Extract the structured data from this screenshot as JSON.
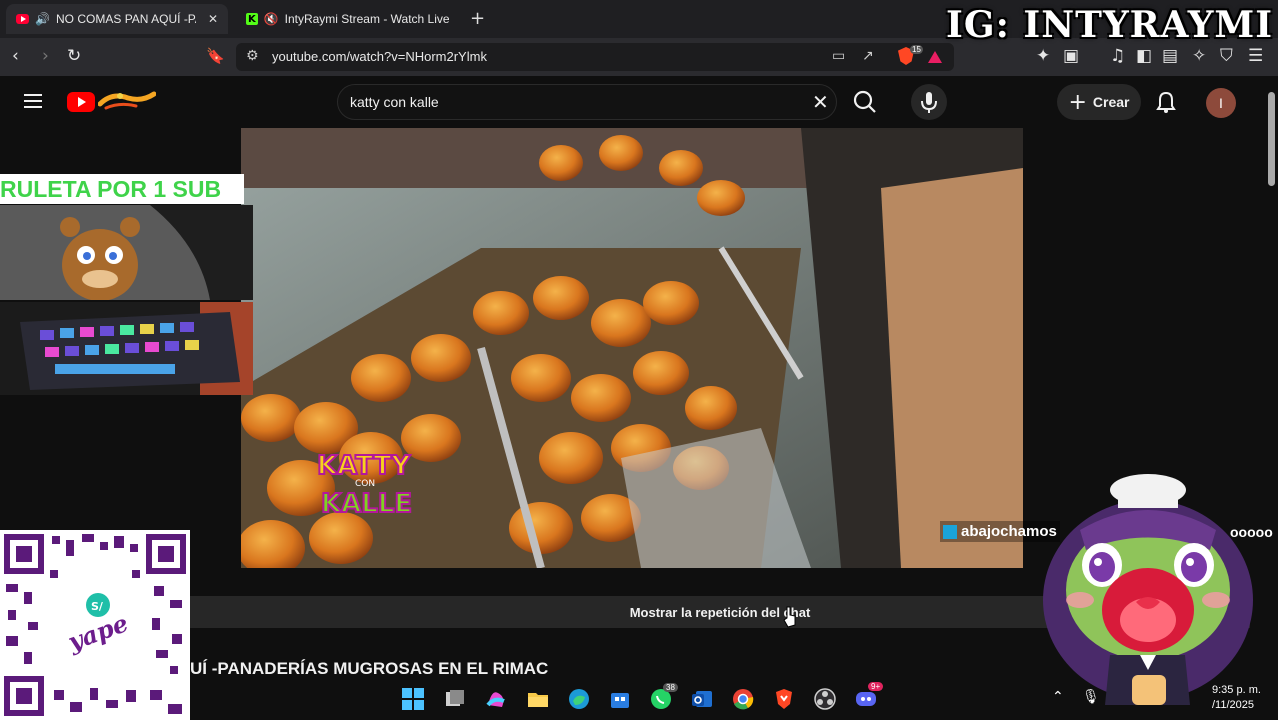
{
  "browser": {
    "tabs": [
      {
        "title": "NO COMAS PAN AQUÍ -PANA",
        "active": true,
        "favicon": "youtube-icon",
        "audio": "speaker-icon"
      },
      {
        "title": "IntyRaymi Stream - Watch Live or",
        "active": false,
        "favicon": "kick-icon",
        "audio": "muted-speaker-icon"
      }
    ],
    "url": "youtube.com/watch?v=NHorm2rYlmk",
    "brave_shield_count": "15"
  },
  "youtube": {
    "search_query": "katty con kalle",
    "create_label": "Crear",
    "avatar_initial": "I",
    "chat_replay_label": "Mostrar la repetición del chat",
    "video_title_visible": "UÍ -PANADERÍAS MUGROSAS EN EL RIMAC",
    "video_watermark": [
      "KATTY",
      "CON",
      "KALLE"
    ]
  },
  "overlays": {
    "instagram": "IG: INTYRAYMI",
    "ruleta": "RULETA POR 1 SUB",
    "chat_username": "abajochamos",
    "chat_message_fragment": "ooooo",
    "qr_brand": "yape",
    "qr_currency": "S/"
  },
  "taskbar": {
    "whatsapp_badge": "38",
    "discord_badge": "9+",
    "time": "9:35 p. m.",
    "date": "/11/2025"
  },
  "colors": {
    "youtube_red": "#ff0000",
    "brave_orange": "#ff4724",
    "ruleta_green": "#3fd34a",
    "yape_purple": "#6c1d8c"
  }
}
